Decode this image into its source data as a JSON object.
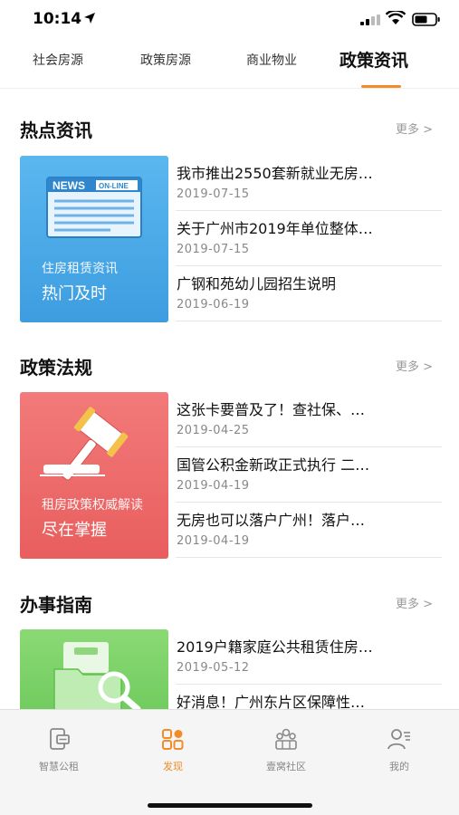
{
  "status_bar": {
    "time": "10:14"
  },
  "tabs": [
    {
      "label": "社会房源"
    },
    {
      "label": "政策房源"
    },
    {
      "label": "商业物业"
    },
    {
      "label": "政策资讯",
      "active": true
    }
  ],
  "sections": [
    {
      "title": "热点资讯",
      "more": "更多 >",
      "banner": {
        "line1": "住房租赁资讯",
        "line2": "热门及时",
        "color": "#4aa8e6",
        "badge1": "NEWS",
        "badge2": "ON-LINE"
      },
      "items": [
        {
          "title": "我市推出2550套新就业无房…",
          "date": "2019-07-15"
        },
        {
          "title": "关于广州市2019年单位整体…",
          "date": "2019-07-15"
        },
        {
          "title": "广钢和苑幼儿园招生说明",
          "date": "2019-06-19"
        }
      ]
    },
    {
      "title": "政策法规",
      "more": "更多 >",
      "banner": {
        "line1": "租房政策权威解读",
        "line2": "尽在掌握",
        "color": "#ee6b6b"
      },
      "items": [
        {
          "title": "这张卡要普及了！查社保、…",
          "date": "2019-04-25"
        },
        {
          "title": "国管公积金新政正式执行 二…",
          "date": "2019-04-19"
        },
        {
          "title": "无房也可以落户广州！落户…",
          "date": "2019-04-19"
        }
      ]
    },
    {
      "title": "办事指南",
      "more": "更多 >",
      "banner": {
        "line1": "",
        "line2": "",
        "color": "#7ed36a"
      },
      "items": [
        {
          "title": "2019户籍家庭公共租赁住房…",
          "date": "2019-05-12"
        },
        {
          "title": "好消息！广州东片区保障性…",
          "date": ""
        }
      ]
    }
  ],
  "bottom_nav": [
    {
      "label": "智慧公租",
      "icon": "phone-card-icon"
    },
    {
      "label": "发现",
      "icon": "discover-icon",
      "active": true
    },
    {
      "label": "壹窝社区",
      "icon": "community-icon"
    },
    {
      "label": "我的",
      "icon": "profile-icon"
    }
  ],
  "colors": {
    "accent": "#f28c28",
    "blue_banner": "#4aa8e6",
    "red_banner": "#ee6b6b",
    "green_banner": "#7ed36a"
  }
}
